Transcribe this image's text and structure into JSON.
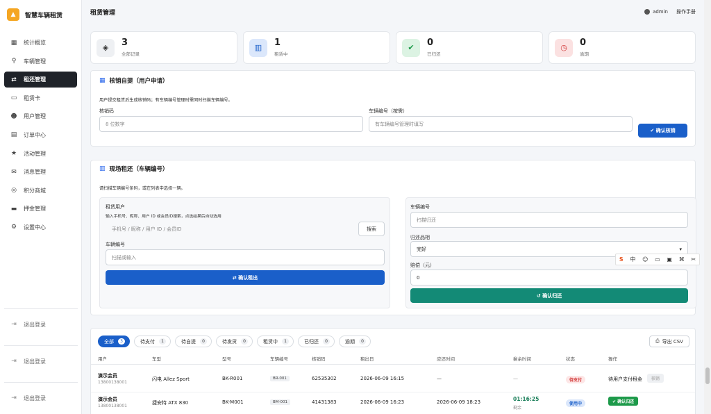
{
  "app": {
    "brand": "智慧车辆租赁"
  },
  "sidebar": {
    "items": [
      {
        "label": "统计概览",
        "icon": "grid-icon",
        "glyph": "▦"
      },
      {
        "label": "车辆管理",
        "icon": "bicycle-icon",
        "glyph": "⚲"
      },
      {
        "label": "租还管理",
        "icon": "swap-icon",
        "glyph": "⇄"
      },
      {
        "label": "租赁卡",
        "icon": "card-icon",
        "glyph": "▭"
      },
      {
        "label": "用户管理",
        "icon": "users-icon",
        "glyph": "☻"
      },
      {
        "label": "订单中心",
        "icon": "receipt-icon",
        "glyph": "▤"
      },
      {
        "label": "活动管理",
        "icon": "star-icon",
        "glyph": "★"
      },
      {
        "label": "消息管理",
        "icon": "mail-icon",
        "glyph": "✉"
      },
      {
        "label": "积分商城",
        "icon": "coins-icon",
        "glyph": "◎"
      },
      {
        "label": "押金管理",
        "icon": "wallet-icon",
        "glyph": "▬"
      },
      {
        "label": "设置中心",
        "icon": "gear-icon",
        "glyph": "⚙"
      }
    ],
    "active_index": 2,
    "logout_label_1": "退出登录",
    "logout_label_2": "退出登录",
    "logout_label_3": "退出登录"
  },
  "header": {
    "title": "租赁管理",
    "user": "admin",
    "action": "操作手册"
  },
  "stats": [
    {
      "value": "3",
      "label": "全部记录",
      "icon": "stack-icon",
      "glyph": "◈",
      "bg": "#eef0f3",
      "fg": "#333333"
    },
    {
      "value": "1",
      "label": "租赁中",
      "icon": "book-icon",
      "glyph": "▥",
      "bg": "#dbe7fb",
      "fg": "#1a5fc9"
    },
    {
      "value": "0",
      "label": "已归还",
      "icon": "check-circle-icon",
      "glyph": "✔",
      "bg": "#dcf3e3",
      "fg": "#1d9a4a"
    },
    {
      "value": "0",
      "label": "逾期",
      "icon": "clock-icon",
      "glyph": "◷",
      "bg": "#fbe1e1",
      "fg": "#d23b3b"
    }
  ],
  "verify": {
    "title": "核销自提（用户申请）",
    "hint": "用户提交租赁后生成核销码；有车辆编号管理时需同时扫描车辆编号。",
    "code_label": "核销码",
    "code_placeholder": "8 位数字",
    "vehicle_label": "车辆编号（按需）",
    "vehicle_placeholder": "有车辆编号管理时填写",
    "confirm": "✔ 确认核销"
  },
  "onsite": {
    "title": "现场租还（车辆编号）",
    "hint": "请扫描车辆编号条码，或在列表中选择一辆。",
    "rent": {
      "user_label": "租赁用户",
      "user_hint": "输入手机号、昵称、用户 ID 或会员ID搜索，点选结果后自动选用",
      "user_placeholder": "手机号 / 昵称 / 用户 ID / 会员ID",
      "search": "搜索",
      "vehicle_label": "车辆编号",
      "vehicle_placeholder": "扫描或输入",
      "confirm": "⇄ 确认租出"
    },
    "return": {
      "vehicle_label": "车辆编号",
      "vehicle_placeholder": "扫描归还",
      "condition_label": "归还品相",
      "condition_value": "完好",
      "fee_label": "赔偿（元）",
      "fee_value": "0",
      "confirm": "↺ 确认归还"
    }
  },
  "records": {
    "tabs": [
      {
        "label": "全部",
        "count": "3"
      },
      {
        "label": "待支付",
        "count": "1"
      },
      {
        "label": "待自提",
        "count": "0"
      },
      {
        "label": "待发货",
        "count": "0"
      },
      {
        "label": "租赁中",
        "count": "1"
      },
      {
        "label": "已归还",
        "count": "0"
      },
      {
        "label": "逾期",
        "count": "0"
      }
    ],
    "export": "导出 CSV",
    "columns": [
      "用户",
      "车型",
      "型号",
      "车辆编号",
      "核销码",
      "租出日",
      "应还时间",
      "剩余时间",
      "状态",
      "操作"
    ],
    "rows": [
      {
        "user": "演示会员",
        "phone": "13800138001",
        "model": "闪电 Allez Sport",
        "sku": "BK-R001",
        "vehicle": "BR-001",
        "code": "62535302",
        "start": "2026-06-09 16:15",
        "due": "—",
        "remain": "—",
        "remain_sub": "",
        "status": "待支付",
        "op": "待用户支付租金",
        "op_btn": "核销"
      },
      {
        "user": "演示会员",
        "phone": "13800138001",
        "model": "捷安特 ATX 830",
        "sku": "BK-M001",
        "vehicle": "BM-001",
        "code": "41431383",
        "start": "2026-06-09 16:23",
        "due": "2026-06-09 18:23",
        "remain": "01:16:25",
        "remain_sub": "剩余",
        "status": "使用中",
        "op": "",
        "op_btn": "✔ 确认归还"
      }
    ]
  },
  "ime": {
    "items": [
      "S",
      "中",
      "☺",
      "▭",
      "▣",
      "⌘",
      "✂"
    ]
  }
}
